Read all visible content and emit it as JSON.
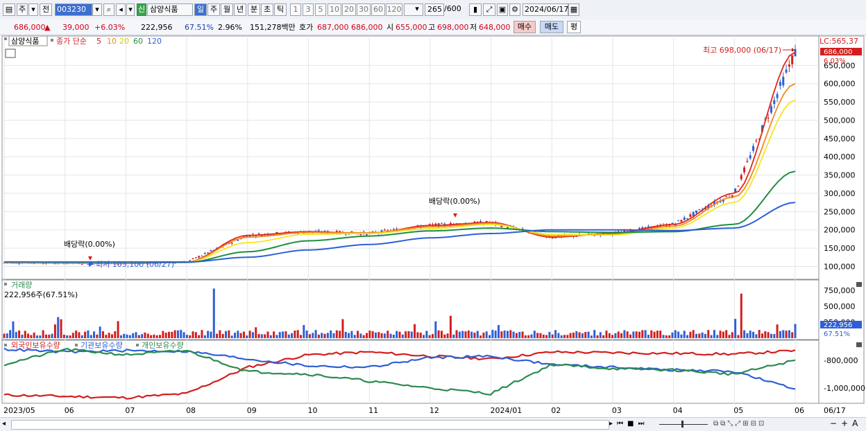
{
  "toolbar": {
    "period_main": "주",
    "prev_label": "전",
    "stock_code": "003230",
    "credit_badge": "신",
    "stock_name": "삼양식품",
    "period_tabs": [
      "일",
      "주",
      "월",
      "년",
      "분",
      "초",
      "틱"
    ],
    "active_period": "일",
    "interval_buttons": [
      "1",
      "3",
      "5",
      "10",
      "20",
      "30",
      "60",
      "120"
    ],
    "count_display": "265",
    "count_total": "/600",
    "date": "2024/06/17"
  },
  "quote": {
    "price": "686,000",
    "change": "39,000",
    "change_pct": "+6.03%",
    "volume": "222,956",
    "volume_ratio": "67.51%",
    "turnover_pct": "2.96%",
    "amount": "151,278백만",
    "bid_label": "호가",
    "bid_values": "687,000  686,000",
    "open_label": "시",
    "open_value": "655,000",
    "high_label": "고",
    "high_value": "698,000",
    "low_label": "저",
    "low_value": "648,000",
    "buy_button": "매수",
    "sell_button": "매도",
    "eval_button": "평"
  },
  "price_panel": {
    "stock_name": "삼양식품",
    "indicator_label": "종가 단순",
    "ma_periods": [
      "5",
      "10",
      "20",
      "60",
      "120"
    ],
    "ma_colors": [
      "#e0261a",
      "#f08a1e",
      "#f6e51e",
      "#1f8e3e",
      "#2d5fd6"
    ],
    "lc_label": "LC:565,37",
    "current_price_tag": "686,000",
    "current_pct_tag": "6.03%",
    "high_annotation": "최고 698,000 (06/17)",
    "low_annotation": "최저 103,100 (06/27)",
    "dividend_label_1": "배당락(0.00%)",
    "dividend_label_2": "배당락(0.00%)",
    "y_ticks": [
      "650,000",
      "600,000",
      "550,000",
      "500,000",
      "450,000",
      "400,000",
      "350,000",
      "300,000",
      "250,000",
      "200,000",
      "150,000",
      "100,000"
    ]
  },
  "volume_panel": {
    "title": "거래량",
    "summary": "222,956주(67.51%)",
    "y_ticks": [
      "750,000",
      "500,000",
      "250,000"
    ],
    "current_tag": "222,956",
    "pct_tag": "67.51%"
  },
  "holdings_panel": {
    "series_labels": [
      "외국인보유수량",
      "기관보유수량",
      "개인보유수량"
    ],
    "series_colors": [
      "#d21e1e",
      "#2d5fd6",
      "#2b8a4e"
    ],
    "y_ticks": [
      "-800,000",
      "-1,000,000"
    ]
  },
  "x_axis": {
    "labels": [
      "2023/05",
      "06",
      "07",
      "08",
      "09",
      "10",
      "11",
      "12",
      "2024/01",
      "02",
      "03",
      "04",
      "05",
      "06"
    ],
    "end_label": "06/17"
  },
  "chart_data": [
    {
      "type": "line",
      "title": "",
      "x": [
        "2023/05",
        "2023/06",
        "2023/07",
        "2023/08",
        "2023/09",
        "2023/10",
        "2023/11",
        "2023/12",
        "2024/01",
        "2024/02",
        "2024/03",
        "2024/04",
        "2024/05",
        "2024/06"
      ],
      "series": [
        {
          "name": "5",
          "values": [
            110000,
            109000,
            108000,
            112000,
            185000,
            195000,
            190000,
            212000,
            220000,
            180000,
            190000,
            215000,
            300000,
            686000
          ]
        },
        {
          "name": "10",
          "values": [
            110000,
            109000,
            109000,
            111000,
            180000,
            193000,
            192000,
            208000,
            218000,
            183000,
            188000,
            210000,
            290000,
            600000
          ]
        },
        {
          "name": "20",
          "values": [
            111000,
            110000,
            110000,
            112000,
            165000,
            188000,
            190000,
            203000,
            215000,
            187000,
            186000,
            205000,
            275000,
            555000
          ]
        },
        {
          "name": "60",
          "values": [
            112000,
            111000,
            111000,
            111000,
            140000,
            170000,
            183000,
            197000,
            205000,
            195000,
            193000,
            195000,
            215000,
            360000
          ]
        },
        {
          "name": "120",
          "values": [
            112000,
            112000,
            112000,
            112000,
            125000,
            145000,
            160000,
            178000,
            190000,
            200000,
            200000,
            198000,
            205000,
            275000
          ]
        }
      ],
      "ylim": [
        80000,
        700000
      ]
    },
    {
      "type": "bar",
      "title": "거래량",
      "current_value": 222956,
      "ylim": [
        0,
        850000
      ]
    },
    {
      "type": "line",
      "series_names": [
        "외국인보유수량",
        "기관보유수량",
        "개인보유수량"
      ],
      "ylim": [
        -1100000,
        -700000
      ]
    }
  ]
}
